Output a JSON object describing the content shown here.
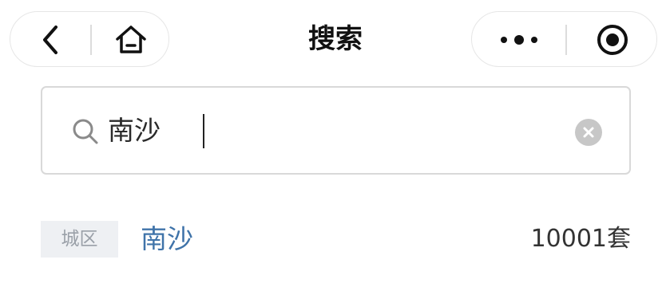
{
  "nav": {
    "title": "搜索",
    "left_capsule": {
      "back_icon": "chevron-left-icon",
      "home_icon": "home-icon"
    },
    "right_capsule": {
      "more_icon": "more-dots-icon",
      "close_icon": "target-circle-icon"
    }
  },
  "search": {
    "value": "南沙",
    "icon": "search-icon",
    "clear_icon": "clear-circle-icon"
  },
  "results": [
    {
      "tag": "城区",
      "name": "南沙",
      "count": "10001套"
    }
  ],
  "colors": {
    "result_name": "#3f73a9",
    "tag_bg": "#eef0f3",
    "tag_text": "#9aa0a8",
    "border": "#d9d9d9"
  }
}
